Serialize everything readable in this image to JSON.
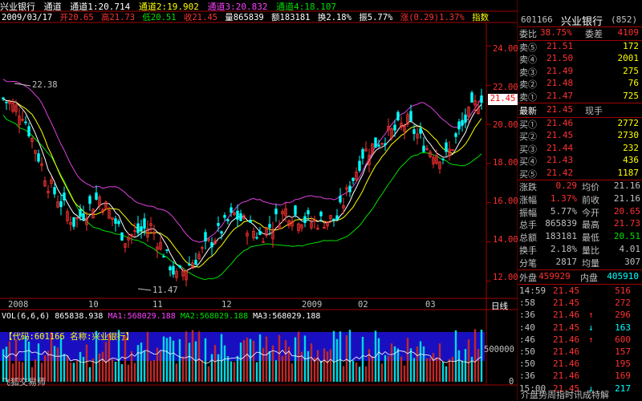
{
  "header": {
    "stock_name": "兴业银行",
    "channels_label": "通道",
    "ch1": "通道1:20.714",
    "ch2": "通道2:19.902",
    "ch3": "通道3:20.832",
    "ch4": "通道4:18.107"
  },
  "infobar": {
    "date": "2009/03/17",
    "open": "开20.65",
    "high": "高21.73",
    "low": "低20.51",
    "close": "收21.45",
    "volume": "量865839",
    "amount": "额183181",
    "turnover": "换2.18%",
    "amplitude": "振5.77%",
    "change": "涨(0.29)1.37%",
    "index_label": "指数"
  },
  "chart_data": {
    "type": "candlestick",
    "y_ticks": [
      "24.00",
      "22.00",
      "20.00",
      "18.00",
      "16.00",
      "14.00",
      "12.00"
    ],
    "ylim": [
      11.2,
      25.2
    ],
    "x_labels": [
      "2008",
      "10",
      "11",
      "12",
      "2009",
      "02",
      "03"
    ],
    "x_axis_right_label": "日线",
    "annotation_high": "22.38",
    "annotation_low": "11.47",
    "price_tag": "21.45",
    "volume_label": "VOL(6,6,6)",
    "volume_value": "865838.938",
    "ma1": "MA1:568029.188",
    "ma2": "MA2:568029.188",
    "ma3": "MA3:568029.188",
    "volume_ticks": [
      "500000",
      "0"
    ],
    "volume_watermark": "【代码:601166 名称:兴业银行】",
    "colors": {
      "up": "#ff3232",
      "down": "#00ffff",
      "ma_white": "#ffffff",
      "ma_yellow": "#ffff00",
      "upper_band": "#e040e0",
      "lower_band": "#00e000"
    }
  },
  "footer_left": "飞狐交易师",
  "footer_right": "介盘势周指时讯成特解",
  "quote": {
    "code": "601166",
    "name": "兴业银行",
    "tag": "(852)",
    "weibi_label": "委比",
    "weibi_value": "38.75%",
    "weicha_label": "委差",
    "weicha_value": "4109",
    "sells": [
      {
        "label": "卖⑤",
        "price": "21.51",
        "vol": "172"
      },
      {
        "label": "卖④",
        "price": "21.50",
        "vol": "2001"
      },
      {
        "label": "卖③",
        "price": "21.49",
        "vol": "275"
      },
      {
        "label": "卖②",
        "price": "21.48",
        "vol": "76"
      },
      {
        "label": "卖①",
        "price": "21.47",
        "vol": "725"
      }
    ],
    "latest_label": "最新",
    "latest_price": "21.45",
    "current_label": "现手",
    "buys": [
      {
        "label": "买①",
        "price": "21.46",
        "vol": "2772"
      },
      {
        "label": "买②",
        "price": "21.45",
        "vol": "2730"
      },
      {
        "label": "买③",
        "price": "21.44",
        "vol": "232"
      },
      {
        "label": "买④",
        "price": "21.43",
        "vol": "436"
      },
      {
        "label": "买⑤",
        "price": "21.42",
        "vol": "1187"
      }
    ],
    "stats": [
      {
        "k": "涨跌",
        "v": "0.29",
        "k2": "均价",
        "v2": "21.16"
      },
      {
        "k": "涨幅",
        "v": "1.37%",
        "k2": "前收",
        "v2": "21.16"
      },
      {
        "k": "振幅",
        "v": "5.77%",
        "k2": "今开",
        "v2": "20.65"
      },
      {
        "k": "总手",
        "v": "865839",
        "k2": "最高",
        "v2": "21.73"
      },
      {
        "k": "总额",
        "v": "183181",
        "k2": "最低",
        "v2": "20.51"
      },
      {
        "k": "换手",
        "v": "2.18%",
        "k2": "量比",
        "v2": "4.01"
      },
      {
        "k": "分笔",
        "v": "2817",
        "k2": "均量",
        "v2": "307"
      }
    ],
    "waipan_label": "外盘",
    "waipan_value": "459929",
    "neipan_label": "内盘",
    "neipan_value": "405910",
    "ticks": [
      {
        "t": "14:59",
        "p": "21.45",
        "a": "",
        "v": "516"
      },
      {
        "t": ":58",
        "p": "21.45",
        "a": "",
        "v": "272"
      },
      {
        "t": ":36",
        "p": "21.46",
        "a": "↑",
        "v": "296"
      },
      {
        "t": ":40",
        "p": "21.45",
        "a": "↓",
        "v": "163"
      },
      {
        "t": ":46",
        "p": "21.46",
        "a": "↑",
        "v": "600"
      },
      {
        "t": ":50",
        "p": "21.46",
        "a": "",
        "v": "157"
      },
      {
        "t": ":50",
        "p": "21.46",
        "a": "",
        "v": "195"
      },
      {
        "t": ":36",
        "p": "21.46",
        "a": "",
        "v": "169"
      },
      {
        "t": "15:00",
        "p": "21.45",
        "a": "↓",
        "v": "217"
      }
    ]
  }
}
